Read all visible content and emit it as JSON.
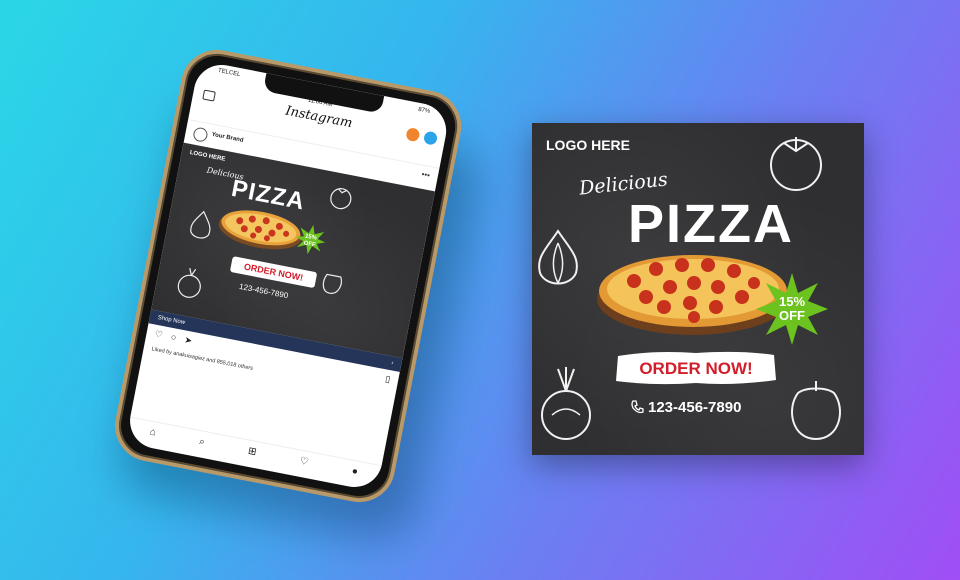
{
  "phone": {
    "carrier": "TELCEL",
    "time": "11:06 AM",
    "battery": "87%",
    "app_name": "Instagram",
    "account": "Your Brand",
    "more_icon": "more-horizontal-icon",
    "cta": "Shop Now",
    "likes_text": "Liked by anakuisagiez and 855,018 others",
    "nav_icons": [
      "home-icon",
      "search-icon",
      "add-icon",
      "heart-icon",
      "profile-icon"
    ]
  },
  "post": {
    "logo": "LOGO HERE",
    "tagline": "Delicious",
    "headline": "PIZZA",
    "badge_line1": "15%",
    "badge_line2": "OFF",
    "cta": "ORDER NOW!",
    "phone": "123-456-7890"
  },
  "colors": {
    "cta_red": "#d31d2a",
    "badge_green": "#6cc21e",
    "chalkboard": "#2f2f31",
    "shop_bar": "#243559"
  }
}
